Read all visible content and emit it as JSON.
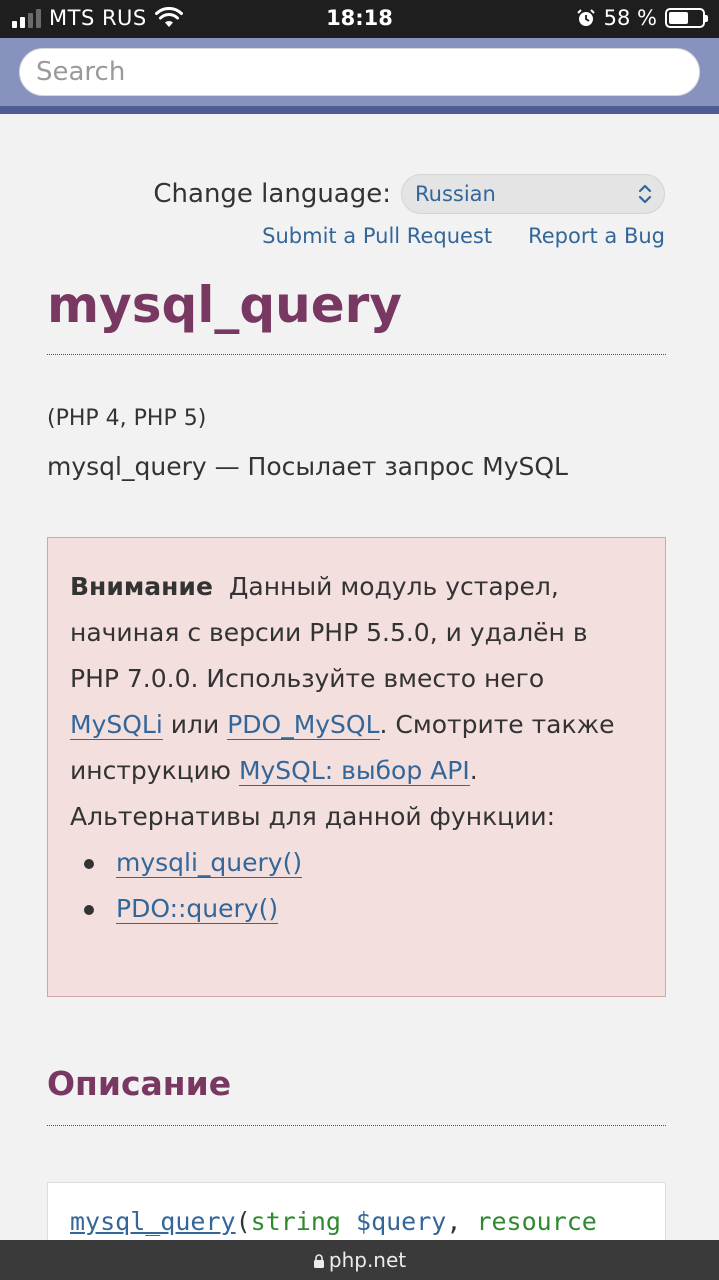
{
  "status_bar": {
    "carrier": "MTS RUS",
    "time": "18:18",
    "battery_percent": "58 %",
    "battery_level": 0.58,
    "icons": [
      "signal-icon",
      "wifi-icon",
      "alarm-icon",
      "battery-icon"
    ]
  },
  "search": {
    "placeholder": "Search",
    "value": ""
  },
  "page": {
    "change_language_label": "Change language:",
    "language_selected": "Russian",
    "submit_pull_request": "Submit a Pull Request",
    "report_bug": "Report a Bug",
    "title": "mysql_query",
    "versions": "(PHP 4, PHP 5)",
    "refpurpose": "mysql_query — Посылает запрос MySQL",
    "warning": {
      "heading": "Внимание",
      "text_1": "Данный модуль устарел, начиная с версии PHP 5.5.0, и удалён в PHP 7.0.0. Используйте вместо него",
      "link_mysqli": "MySQLi",
      "text_or": "или",
      "link_pdo_mysql": "PDO_MySQL",
      "text_2": ". Смотрите также инструкцию",
      "link_api": "MySQL: выбор API",
      "text_3": ". Альтернативы для данной функции:",
      "alternatives": [
        "mysqli_query()",
        "PDO::query()"
      ]
    },
    "description_heading": "Описание",
    "signature": {
      "function": "mysql_query",
      "open_paren": "(",
      "type_1": "string",
      "param_1": "$query",
      "comma": ",",
      "type_2": "resource"
    }
  },
  "url_bar": {
    "domain": "php.net"
  },
  "colors": {
    "header_bg": "#8892bf",
    "header_border": "#4f5b93",
    "title": "#793862",
    "link": "#336699",
    "warning_bg": "#f4dfdf",
    "warning_border": "#d0a7a7",
    "code_type": "#2f8a2f"
  }
}
